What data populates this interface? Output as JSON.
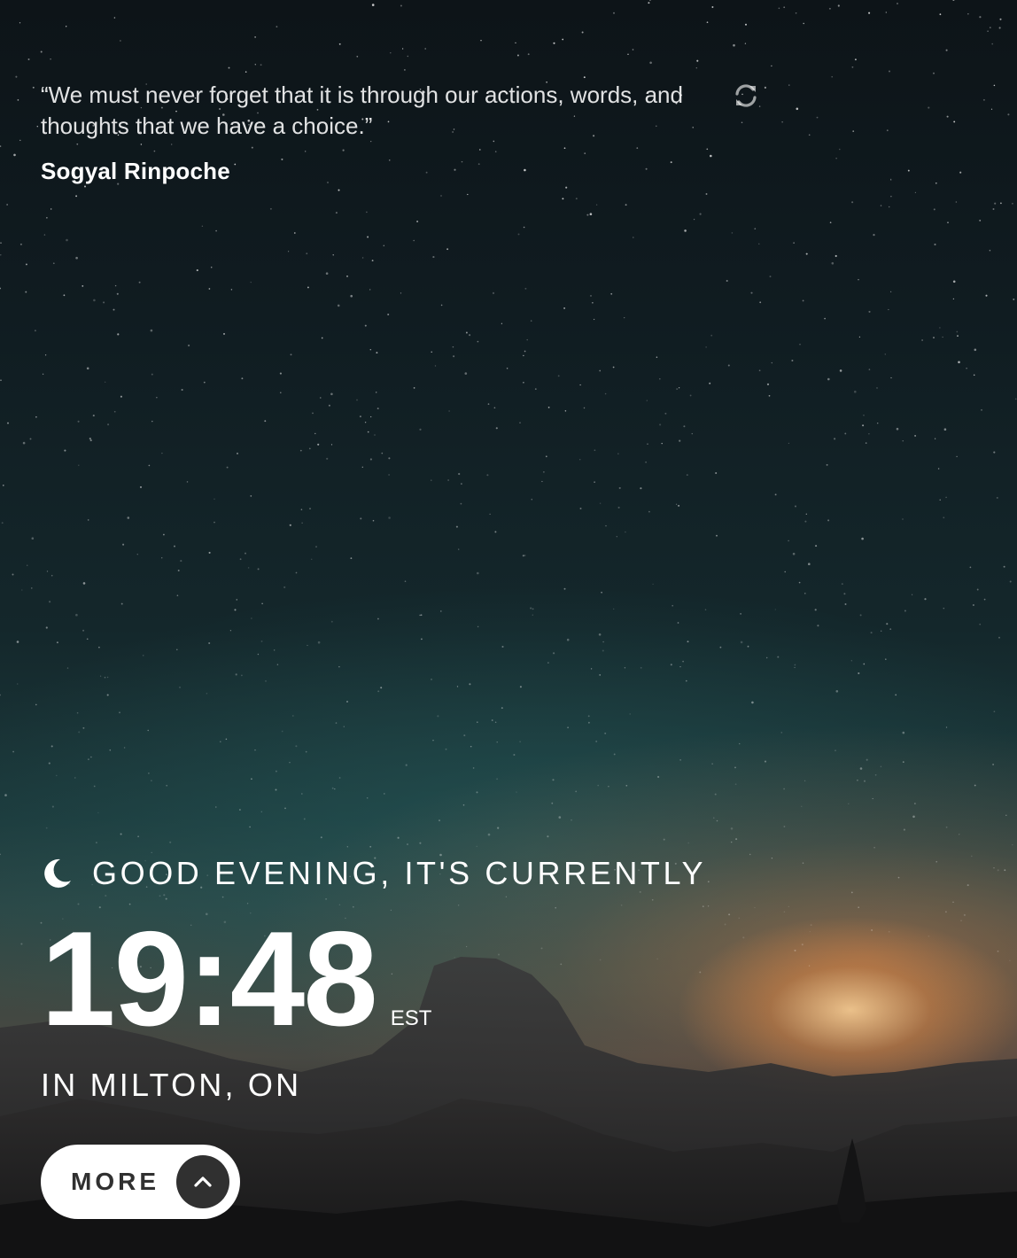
{
  "quote": {
    "text": "“We must never forget that it is through our actions, words, and thoughts that we have a choice.”",
    "author": "Sogyal Rinpoche",
    "refresh_icon": "refresh-icon"
  },
  "greeting": {
    "icon": "moon-icon",
    "text": "GOOD EVENING, IT'S CURRENTLY"
  },
  "clock": {
    "time": "19:48",
    "timezone": "EST"
  },
  "location": {
    "text": "IN MILTON, ON"
  },
  "more_button": {
    "label": "MORE",
    "icon": "chevron-up-icon"
  },
  "colors": {
    "text": "#ffffff",
    "button_bg": "#ffffff",
    "button_dark": "#303030"
  }
}
